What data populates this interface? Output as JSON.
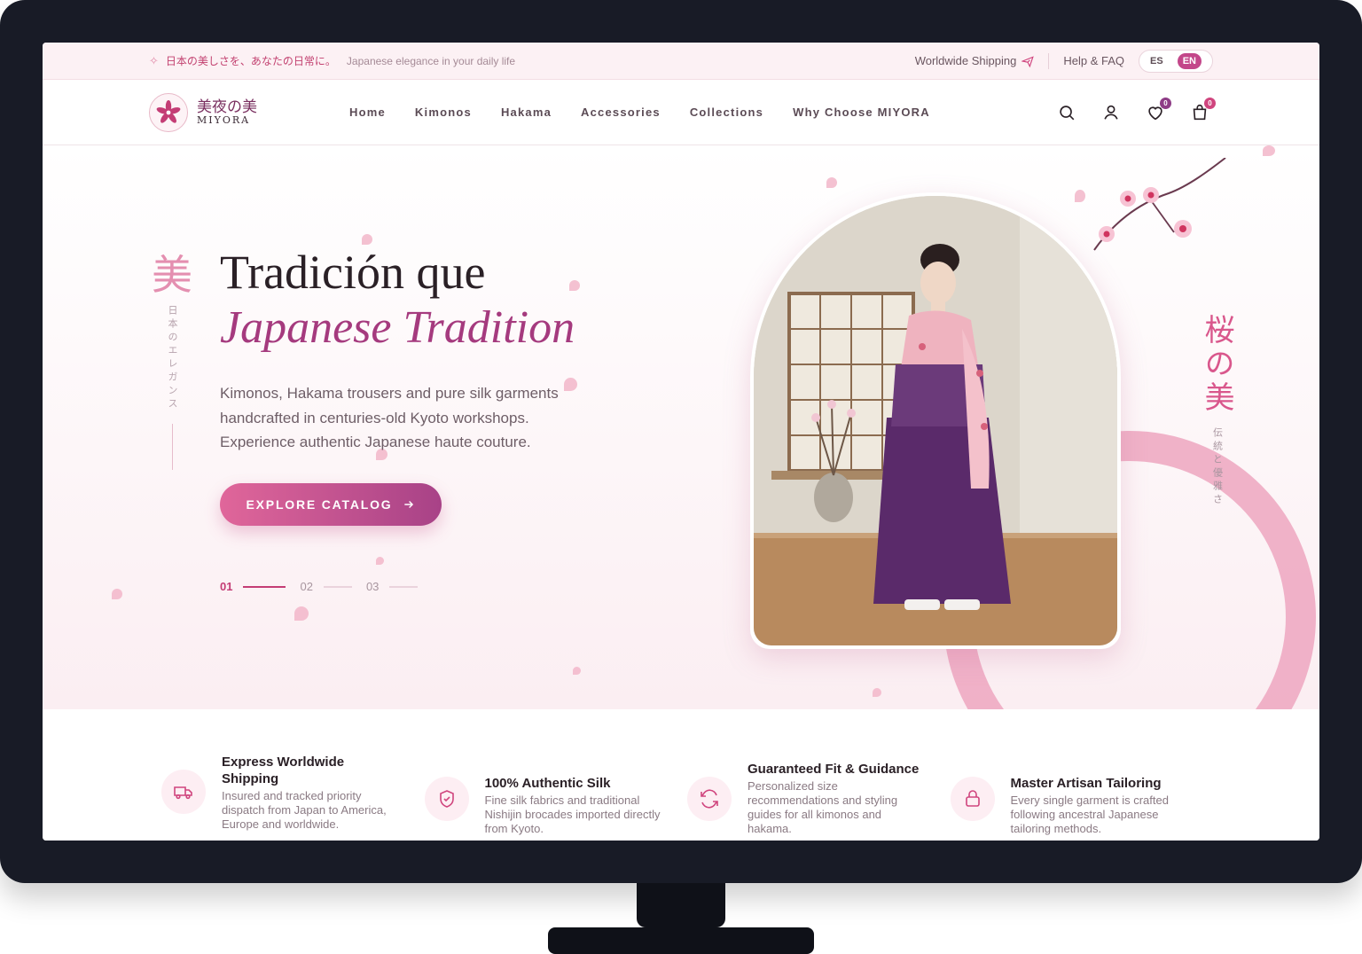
{
  "topbar": {
    "jp_text": "日本の美しさを、あなたの日常に。",
    "tagline": "Japanese elegance in your daily life",
    "shipping": "Worldwide Shipping",
    "help": "Help & FAQ",
    "lang_es": "ES",
    "lang_en": "EN"
  },
  "logo": {
    "kanji": "美夜の美",
    "latin": "MIYORA"
  },
  "nav": {
    "items": [
      "Home",
      "Kimonos",
      "Hakama",
      "Accessories",
      "Collections",
      "Why Choose MIYORA"
    ],
    "wishlist_count": "0",
    "cart_count": "0"
  },
  "hero": {
    "side_kanji": "美",
    "side_text": "日本のエレガンス",
    "title_line1": "Tradición que",
    "title_line2": "Japanese Tradition",
    "description": "Kimonos, Hakama trousers and pure silk garments handcrafted in centuries-old Kyoto workshops. Experience authentic Japanese haute couture.",
    "cta_label": "EXPLORE CATALOG",
    "slides": [
      "01",
      "02",
      "03"
    ],
    "right_kanji": "桜の美",
    "right_text": "伝統と優雅さ"
  },
  "features": [
    {
      "icon": "truck-icon",
      "title": "Express Worldwide Shipping",
      "text": "Insured and tracked priority dispatch from Japan to America, Europe and worldwide."
    },
    {
      "icon": "shield-check-icon",
      "title": "100% Authentic Silk",
      "text": "Fine silk fabrics and traditional Nishijin brocades imported directly from Kyoto."
    },
    {
      "icon": "refresh-icon",
      "title": "Guaranteed Fit & Guidance",
      "text": "Personalized size recommendations and styling guides for all kimonos and hakama."
    },
    {
      "icon": "lock-icon",
      "title": "Master Artisan Tailoring",
      "text": "Every single garment is crafted following ancestral Japanese tailoring methods."
    }
  ],
  "colors": {
    "accent": "#c43d75",
    "accent_purple": "#a84287",
    "petal": "#f2b6c9",
    "frame": "#181b26"
  }
}
